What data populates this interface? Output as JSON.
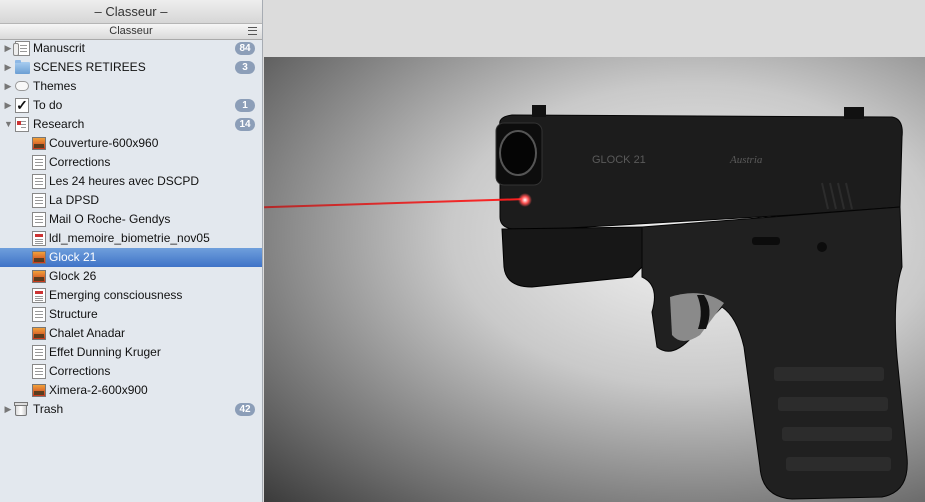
{
  "window": {
    "title": "– Classeur –"
  },
  "binder": {
    "header": "Classeur",
    "items": [
      {
        "label": "Manuscrit",
        "icon": "draft-folder-icon",
        "badge": "84",
        "disclosure": "collapsed",
        "level": 0
      },
      {
        "label": "SCENES RETIREES",
        "icon": "folder-icon",
        "badge": "3",
        "disclosure": "collapsed",
        "level": 0
      },
      {
        "label": "Themes",
        "icon": "cloud-icon",
        "badge": "",
        "disclosure": "collapsed",
        "level": 0
      },
      {
        "label": "To do",
        "icon": "checkbox-icon",
        "badge": "1",
        "disclosure": "collapsed",
        "level": 0
      },
      {
        "label": "Research",
        "icon": "research-folder-icon",
        "badge": "14",
        "disclosure": "expanded",
        "level": 0
      },
      {
        "label": "Couverture-600x960",
        "icon": "image-icon",
        "badge": "",
        "disclosure": "",
        "level": 1
      },
      {
        "label": "Corrections",
        "icon": "document-icon",
        "badge": "",
        "disclosure": "",
        "level": 1
      },
      {
        "label": "Les 24 heures avec DSCPD",
        "icon": "document-icon",
        "badge": "",
        "disclosure": "",
        "level": 1
      },
      {
        "label": "La DPSD",
        "icon": "document-icon",
        "badge": "",
        "disclosure": "",
        "level": 1
      },
      {
        "label": "Mail O Roche- Gendys",
        "icon": "document-icon",
        "badge": "",
        "disclosure": "",
        "level": 1
      },
      {
        "label": "ldl_memoire_biometrie_nov05",
        "icon": "pdf-icon",
        "badge": "",
        "disclosure": "",
        "level": 1
      },
      {
        "label": "Glock 21",
        "icon": "image-icon",
        "badge": "",
        "disclosure": "",
        "level": 1,
        "selected": true
      },
      {
        "label": "Glock 26",
        "icon": "image-icon",
        "badge": "",
        "disclosure": "",
        "level": 1
      },
      {
        "label": "Emerging consciousness",
        "icon": "pdf-icon",
        "badge": "",
        "disclosure": "",
        "level": 1
      },
      {
        "label": "Structure",
        "icon": "document-icon",
        "badge": "",
        "disclosure": "",
        "level": 1
      },
      {
        "label": "Chalet Anadar",
        "icon": "image-icon",
        "badge": "",
        "disclosure": "",
        "level": 1
      },
      {
        "label": "Effet Dunning Kruger",
        "icon": "document-icon",
        "badge": "",
        "disclosure": "",
        "level": 1
      },
      {
        "label": "Corrections",
        "icon": "document-icon",
        "badge": "",
        "disclosure": "",
        "level": 1
      },
      {
        "label": "Ximera-2-600x900",
        "icon": "image-icon",
        "badge": "",
        "disclosure": "",
        "level": 1
      },
      {
        "label": "Trash",
        "icon": "trash-icon",
        "badge": "42",
        "disclosure": "collapsed",
        "level": 0
      }
    ]
  },
  "viewer": {
    "image": "glock-pistol-photo",
    "slide_markings": [
      "GLOCK 21",
      "Austria"
    ],
    "colors": {
      "laser": "#ff2020",
      "selection": "#3f73c7",
      "badge": "#8c9eb8"
    }
  }
}
